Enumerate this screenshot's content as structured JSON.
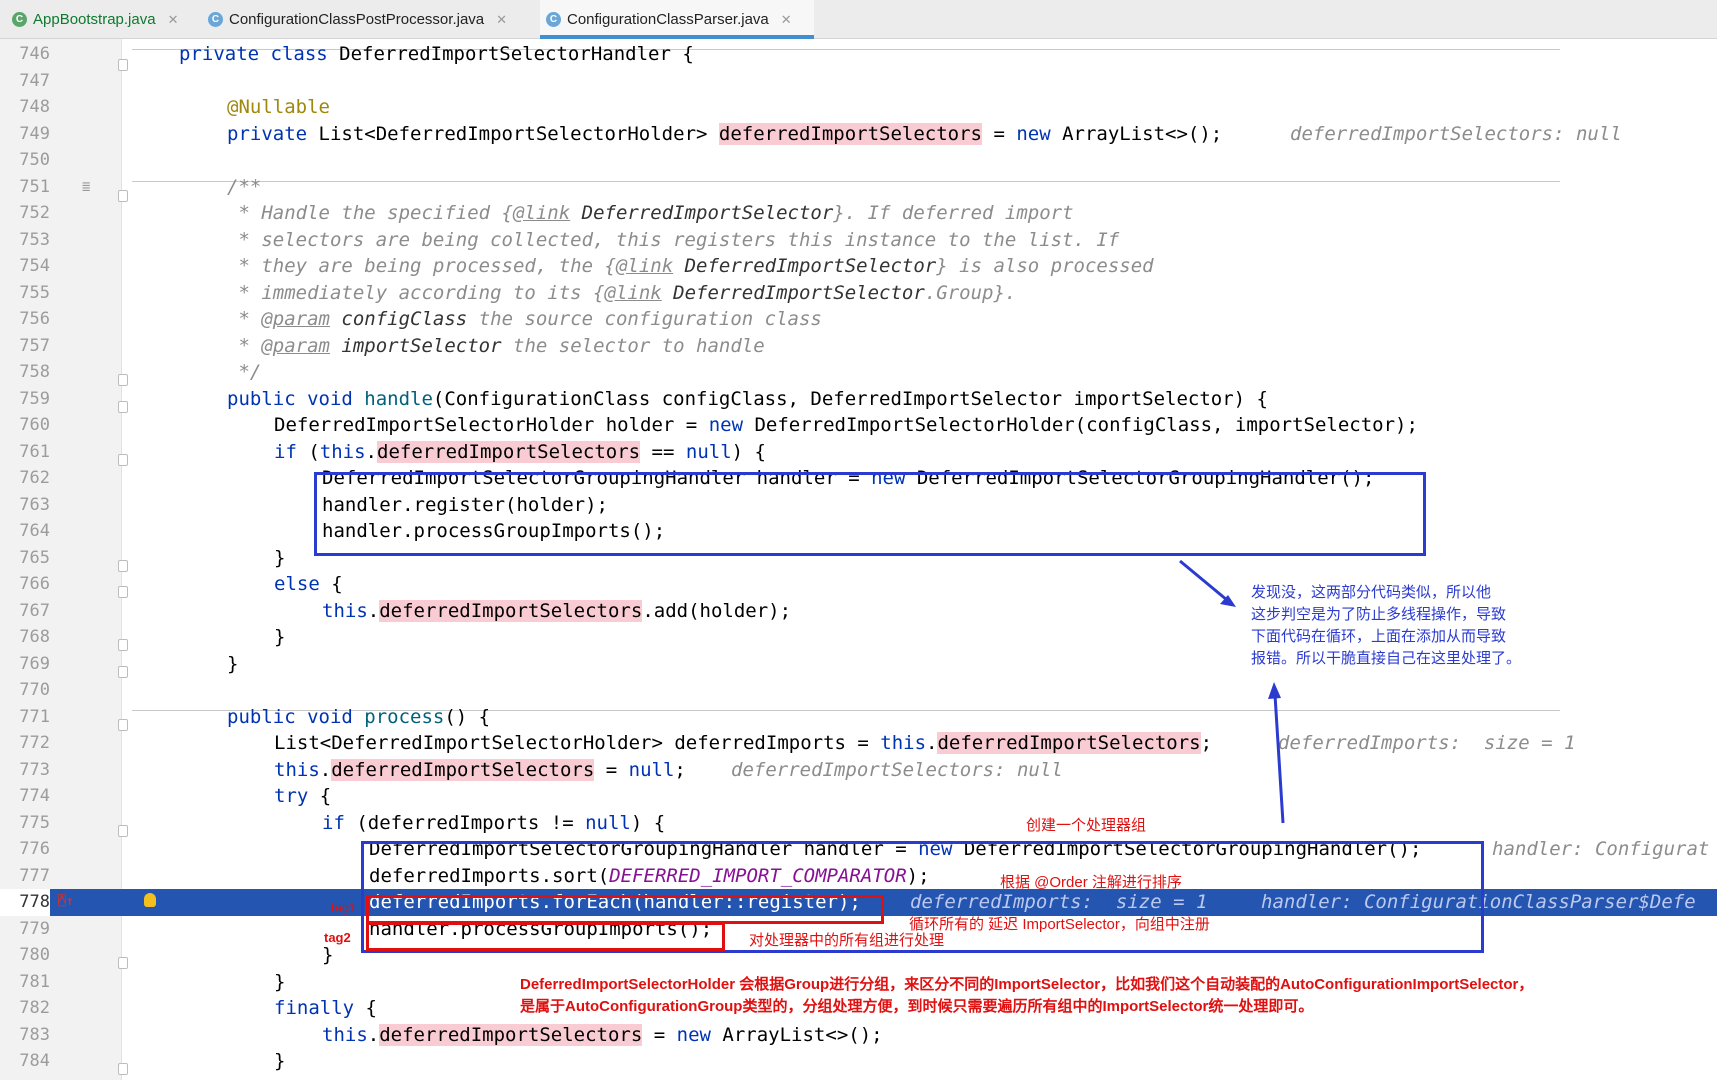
{
  "tabs": [
    {
      "name": "AppBootstrap.java",
      "color": "#0e7a2f"
    },
    {
      "name": "ConfigurationClassPostProcessor.java",
      "color": "#222222"
    },
    {
      "name": "ConfigurationClassParser.java",
      "color": "#222222"
    }
  ],
  "active_tab": "ConfigurationClassParser.java",
  "line_numbers": [
    "746",
    "747",
    "748",
    "749",
    "750",
    "751",
    "752",
    "753",
    "754",
    "755",
    "756",
    "757",
    "758",
    "759",
    "760",
    "761",
    "762",
    "763",
    "764",
    "765",
    "766",
    "767",
    "768",
    "769",
    "770",
    "771",
    "772",
    "773",
    "774",
    "775",
    "776",
    "777",
    "778",
    "779",
    "780",
    "781",
    "782",
    "783",
    "784"
  ],
  "highlighted_line": "778",
  "code": {
    "l746": [
      "private class",
      " DeferredImportSelectorHandler {"
    ],
    "l748": "@Nullable",
    "l749": [
      "private",
      " List<DeferredImportSelectorHolder> ",
      "deferredImportSelectors",
      " = ",
      "new",
      " ArrayList<>();",
      "deferredImportSelectors: null"
    ],
    "l751": "/**",
    "l752": [
      " * Handle the specified {",
      "@link",
      " DeferredImportSelector",
      "}. If deferred import"
    ],
    "l753": " * selectors are being collected, this registers this instance to the list. If",
    "l754": [
      " * they are being processed, the {",
      "@link",
      " DeferredImportSelector",
      "} is also processed"
    ],
    "l755": [
      " * immediately according to its {",
      "@link",
      " DeferredImportSelector",
      ".Group",
      "}."
    ],
    "l756": [
      " * ",
      "@param",
      " configClass",
      " the source configuration class"
    ],
    "l757": [
      " * ",
      "@param",
      " importSelector",
      " the selector to handle"
    ],
    "l758": " */",
    "l759": [
      "public void",
      " handle",
      "(ConfigurationClass configClass, DeferredImportSelector importSelector) {"
    ],
    "l760": [
      "DeferredImportSelectorHolder holder = ",
      "new",
      " DeferredImportSelectorHolder(configClass, importSelector);"
    ],
    "l761": [
      "if",
      " (",
      "this",
      ".",
      "deferredImportSelectors",
      " == ",
      "null",
      ") {"
    ],
    "l762": [
      "DeferredImportSelectorGroupingHandler handler = ",
      "new",
      " DeferredImportSelectorGroupingHandler();"
    ],
    "l763": "handler.register(holder);",
    "l764": "handler.processGroupImports();",
    "l765": "}",
    "l766": [
      "else",
      " {"
    ],
    "l767": [
      "this",
      ".",
      "deferredImportSelectors",
      ".add(holder);"
    ],
    "l768": "}",
    "l769": "}",
    "l771": [
      "public void",
      " process",
      "() {"
    ],
    "l772": [
      "List<DeferredImportSelectorHolder> deferredImports = ",
      "this",
      ".",
      "deferredImportSelectors",
      ";",
      "deferredImports:  size = 1"
    ],
    "l773": [
      "this",
      ".",
      "deferredImportSelectors",
      " = ",
      "null",
      ";",
      "deferredImportSelectors: null"
    ],
    "l774": [
      "try",
      " {"
    ],
    "l775": [
      "if",
      " (deferredImports != ",
      "null",
      ") {"
    ],
    "l776": [
      "DeferredImportSelectorGroupingHandler handler = ",
      "new",
      " DeferredImportSelectorGroupingHandler();",
      "handler: Configurat"
    ],
    "l777": [
      "deferredImports.sort(",
      "DEFERRED_IMPORT_COMPARATOR",
      ");"
    ],
    "l778": [
      "deferredImports.forEach(handler::register);",
      "deferredImports:  size = 1",
      "handler: ConfigurationClassParser$Defe"
    ],
    "l779": "handler.processGroupImports();",
    "l780": "}",
    "l781": "}",
    "l782": [
      "finally",
      " {"
    ],
    "l783": [
      "this",
      ".",
      "deferredImportSelectors",
      " = ",
      "new",
      " ArrayList<>();"
    ],
    "l784": "}"
  },
  "annotations": {
    "blue_note": [
      "发现没，这两部分代码类似，所以他",
      "这步判空是为了防止多线程操作，导致",
      "下面代码在循环，上面在添加从而导致",
      "报错。所以干脆直接自己在这里处理了。"
    ],
    "create_group": "创建一个处理器组",
    "sort_note": "根据 @Order 注解进行排序",
    "tag1": "tag1",
    "tag2": "tag2",
    "loop_note": "循环所有的 延迟 ImportSelector，向组中注册",
    "process_note": "对处理器中的所有组进行处理",
    "bottom_note": [
      "DeferredImportSelectorHolder 会根据Group进行分组，来区分不同的ImportSelector，比如我们这个自动装配的AutoConfigurationImportSelector，",
      "是属于AutoConfigurationGroup类型的，分组处理方便，到时候只需要遍历所有组中的ImportSelector统一处理即可。"
    ]
  },
  "colors": {
    "keyword": "#0033b3",
    "annotation": "#9e880d",
    "field_highlight": "#f9ccd3",
    "comment": "#8c8c8c",
    "constant": "#871094",
    "selected_line": "#2456b1",
    "note_blue": "#2b3bd0",
    "note_red": "#e01010"
  }
}
